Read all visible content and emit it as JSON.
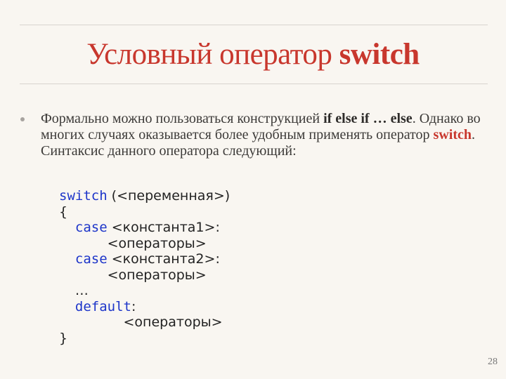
{
  "slide": {
    "title_regular": "Условный оператор ",
    "title_bold": "switch",
    "bullet": {
      "text_1": "Формально можно пользоваться конструкцией ",
      "bold_1": "if else if … else",
      "text_2": ". Однако во многих случаях оказывается более удобным применять оператор ",
      "keyword": "switch",
      "text_3": ". Синтаксис данного оператора следующий:"
    },
    "code": [
      {
        "indent": "",
        "kw": "switch",
        "rest": " (<переменная>)"
      },
      {
        "indent": "",
        "kw": "",
        "rest": "{"
      },
      {
        "indent": "  ",
        "kw": "case",
        "rest": " <константа1>:"
      },
      {
        "indent": "      ",
        "kw": "",
        "rest": "<операторы>"
      },
      {
        "indent": "  ",
        "kw": "case",
        "rest": " <константа2>:"
      },
      {
        "indent": "      ",
        "kw": "",
        "rest": "<операторы>"
      },
      {
        "indent": "  ",
        "kw": "",
        "rest": "…"
      },
      {
        "indent": "  ",
        "kw": "default",
        "rest": ":"
      },
      {
        "indent": "        ",
        "kw": "",
        "rest": "<операторы>"
      },
      {
        "indent": "",
        "kw": "",
        "rest": "}"
      }
    ],
    "page_number": "28"
  }
}
